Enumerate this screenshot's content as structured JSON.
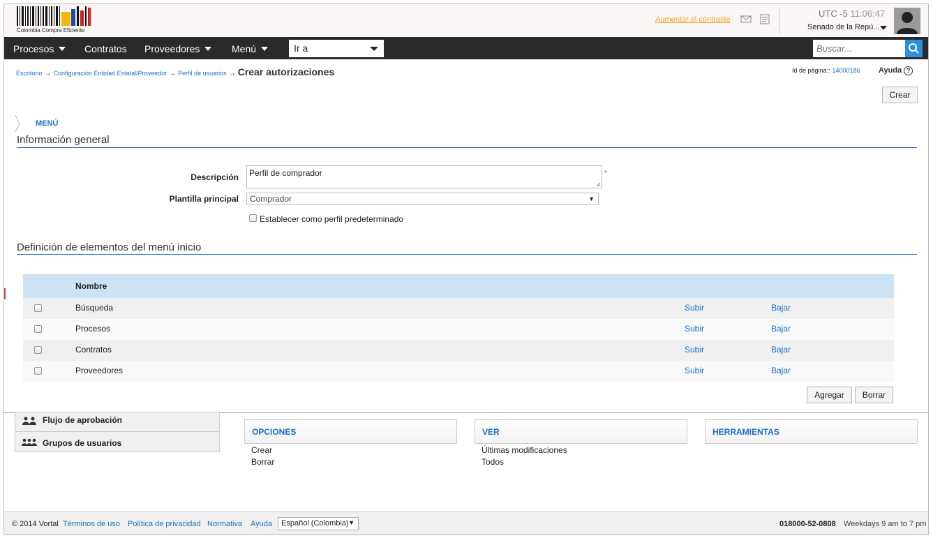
{
  "header": {
    "logo_text": "Colombia Compra Eficiente",
    "contrast_link": "Aumentar el contraste",
    "tz_label": "UTC -5",
    "time": "11:06:47",
    "entity": "Senado de la Repú...",
    "icons": [
      "mail-icon",
      "document-icon",
      "user-avatar"
    ]
  },
  "nav": {
    "items": [
      "Procesos",
      "Contratos",
      "Proveedores",
      "Menú"
    ],
    "goto_label": "Ir a",
    "search_placeholder": "Buscar..."
  },
  "breadcrumb": {
    "items": [
      "Escritorio",
      "Configuración Entidad Estatal/Proveedor",
      "Perfil de usuarios"
    ],
    "current": "Crear autorizaciones",
    "page_id_label": "Id de página::",
    "page_id": "14000186",
    "help": "Ayuda"
  },
  "actions": {
    "create": "Crear",
    "add": "Agregar",
    "delete": "Borrar"
  },
  "menu_label": "MENÚ",
  "general": {
    "title": "Información general",
    "description_label": "Descripción",
    "description_value": "Perfil de comprador",
    "template_label": "Plantilla principal",
    "template_value": "Comprador",
    "default_checkbox": "Establecer como perfil predeterminado"
  },
  "menu_def": {
    "title": "Definición de elementos del menú inicio",
    "column": "Nombre",
    "up": "Subir",
    "down": "Bajar",
    "rows": [
      "Búsqueda",
      "Procesos",
      "Contratos",
      "Proveedores"
    ]
  },
  "side_panel": {
    "items": [
      "Flujo de aprobación",
      "Grupos de usuarios"
    ]
  },
  "boxes": {
    "options": {
      "title": "OPCIONES",
      "links": [
        "Crear",
        "Borrar"
      ]
    },
    "view": {
      "title": "VER",
      "links": [
        "Últimas modificaciones",
        "Todos"
      ]
    },
    "tools": {
      "title": "HERRAMIENTAS"
    }
  },
  "footer": {
    "copyright": "© 2014 Vortal",
    "links": [
      "Términos de uso",
      "Política de privacidad",
      "Normativa",
      "Ayuda"
    ],
    "language": "Español (Colombia)",
    "phone": "018000-52-0808",
    "hours": "Weekdays 9 am to 7 pm"
  }
}
